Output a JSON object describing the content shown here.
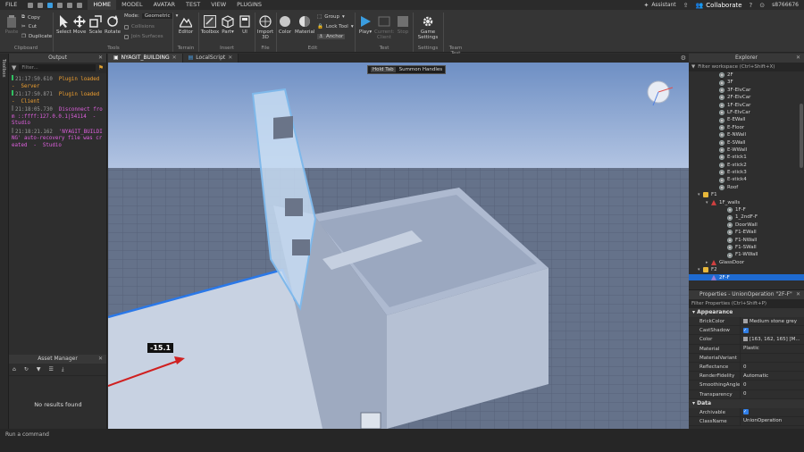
{
  "menubar": {
    "tabs": [
      "FILE",
      "HOME",
      "MODEL",
      "AVATAR",
      "TEST",
      "VIEW",
      "PLUGINS"
    ],
    "active_tab": "HOME",
    "assistant": "Assistant",
    "collaborate": "Collaborate",
    "user": "s8766676"
  },
  "ribbon": {
    "clipboard": {
      "paste": "Paste",
      "copy": "Copy",
      "cut": "Cut",
      "duplicate": "Duplicate",
      "label": "Clipboard"
    },
    "tools": {
      "select": "Select",
      "move": "Move",
      "scale": "Scale",
      "rotate": "Rotate",
      "mode_label": "Mode:",
      "mode_value": "Geometric",
      "collisions": "Collisions",
      "join_surfaces": "Join Surfaces",
      "label": "Tools"
    },
    "terrain": {
      "editor": "Editor",
      "label": "Terrain"
    },
    "insert": {
      "toolbox": "Toolbox",
      "part": "Part",
      "ui": "UI",
      "label": "Insert"
    },
    "file": {
      "import3d": "Import 3D",
      "label": "File"
    },
    "edit": {
      "color": "Color",
      "material": "Material",
      "group": "Group",
      "lock_tool": "Lock Tool",
      "anchor": "Anchor",
      "label": "Edit"
    },
    "test": {
      "play": "Play",
      "current_client": "Current: Client",
      "stop": "Stop",
      "label": "Test"
    },
    "settings": {
      "game_settings": "Game Settings",
      "label": "Settings"
    },
    "team_test": {
      "label": "Team Test"
    }
  },
  "left_strip": {
    "toolbox_label": "Toolbox"
  },
  "output": {
    "title": "Output",
    "filter_placeholder": "Filter...",
    "logs": [
      {
        "time": "21:17:50.610",
        "text": "Plugin loaded  -  Server",
        "color": "#f0a030"
      },
      {
        "time": "21:17:50.871",
        "text": "Plugin loaded  -  Client",
        "color": "#f0a030"
      },
      {
        "time": "21:18:05.730",
        "text": "Disconnect from ::ffff:127.0.0.1|54114  -  Studio",
        "color": "#e060e0"
      },
      {
        "time": "21:18:21.162",
        "text": "'NYAGIT_BUILDING' auto-recovery file was created  -  Studio",
        "color": "#e060e0"
      }
    ]
  },
  "asset_manager": {
    "title": "Asset Manager",
    "empty_text": "No results found"
  },
  "doc_tabs": [
    {
      "label": "NYAGIT_BUILDING",
      "active": true
    },
    {
      "label": "LocalScript",
      "active": false
    }
  ],
  "viewport": {
    "tooltip_key": "Hold Tab",
    "tooltip_text": "Summon Handles",
    "dimension_label": "-15.1"
  },
  "explorer": {
    "title": "Explorer",
    "filter_placeholder": "Filter workspace (Ctrl+Shift+X)",
    "items": [
      {
        "label": "2F",
        "indent": 4,
        "icon": "part"
      },
      {
        "label": "3F",
        "indent": 4,
        "icon": "part"
      },
      {
        "label": "3F-ElvCar",
        "indent": 4,
        "icon": "part"
      },
      {
        "label": "2F-ElvCar",
        "indent": 4,
        "icon": "part"
      },
      {
        "label": "1F-ElvCar",
        "indent": 4,
        "icon": "part"
      },
      {
        "label": "LF-ElvCar",
        "indent": 4,
        "icon": "part"
      },
      {
        "label": "E-EWall",
        "indent": 4,
        "icon": "part"
      },
      {
        "label": "E-Floor",
        "indent": 4,
        "icon": "part"
      },
      {
        "label": "E-NWall",
        "indent": 4,
        "icon": "part"
      },
      {
        "label": "E-SWall",
        "indent": 4,
        "icon": "part"
      },
      {
        "label": "E-WWall",
        "indent": 4,
        "icon": "part"
      },
      {
        "label": "E-stick1",
        "indent": 4,
        "icon": "part"
      },
      {
        "label": "E-stick2",
        "indent": 4,
        "icon": "part"
      },
      {
        "label": "E-stick3",
        "indent": 4,
        "icon": "part"
      },
      {
        "label": "E-stick4",
        "indent": 4,
        "icon": "part"
      },
      {
        "label": "Roof",
        "indent": 4,
        "icon": "part"
      },
      {
        "label": "F1",
        "indent": 2,
        "icon": "folder",
        "arrow": "▾"
      },
      {
        "label": "1F_walls",
        "indent": 3,
        "icon": "model",
        "arrow": "▾"
      },
      {
        "label": "1F-F",
        "indent": 5,
        "icon": "part"
      },
      {
        "label": "1_2ndF-F",
        "indent": 5,
        "icon": "part"
      },
      {
        "label": "DoorWall",
        "indent": 5,
        "icon": "part"
      },
      {
        "label": "F1-EWall",
        "indent": 5,
        "icon": "part"
      },
      {
        "label": "F1-NWall",
        "indent": 5,
        "icon": "part"
      },
      {
        "label": "F1-SWall",
        "indent": 5,
        "icon": "part"
      },
      {
        "label": "F1-WWall",
        "indent": 5,
        "icon": "part"
      },
      {
        "label": "GlassDoor",
        "indent": 3,
        "icon": "model",
        "arrow": "▸"
      },
      {
        "label": "F2",
        "indent": 2,
        "icon": "folder",
        "arrow": "▾"
      },
      {
        "label": "2F-F",
        "indent": 3,
        "icon": "union",
        "selected": true
      }
    ]
  },
  "properties": {
    "title": "Properties - UnionOperation \"2F-F\"",
    "filter_placeholder": "Filter Properties (Ctrl+Shift+P)",
    "sections": [
      {
        "name": "Appearance",
        "rows": [
          {
            "name": "BrickColor",
            "value": "Medium stone grey",
            "swatch": "#a3a2a5"
          },
          {
            "name": "CastShadow",
            "check": true
          },
          {
            "name": "Color",
            "value": "[163, 162, 165] [M...",
            "swatch": "#a3a2a5"
          },
          {
            "name": "Material",
            "value": "Plastic"
          },
          {
            "name": "MaterialVariant",
            "value": ""
          },
          {
            "name": "Reflectance",
            "value": "0"
          },
          {
            "name": "RenderFidelity",
            "value": "Automatic"
          },
          {
            "name": "SmoothingAngle",
            "value": "0"
          },
          {
            "name": "Transparency",
            "value": "0"
          }
        ]
      },
      {
        "name": "Data",
        "rows": [
          {
            "name": "Archivable",
            "check": true
          },
          {
            "name": "ClassName",
            "value": "UnionOperation"
          }
        ]
      }
    ]
  },
  "command_bar": {
    "placeholder": "Run a command"
  }
}
